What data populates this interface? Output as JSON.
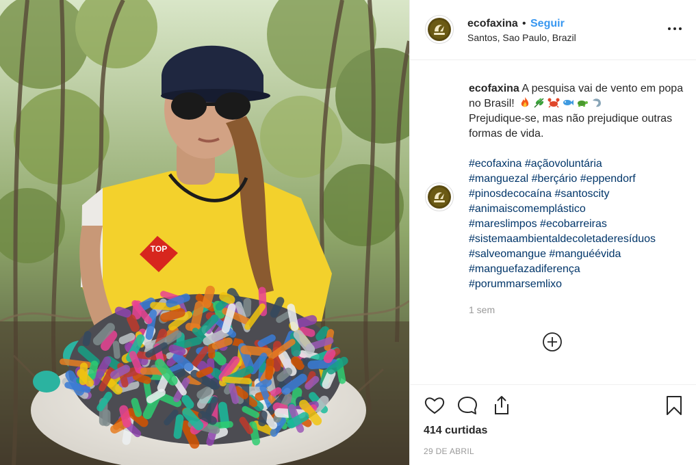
{
  "post": {
    "username": "ecofaxina",
    "separator": "•",
    "follow_label": "Seguir",
    "location": "Santos, Sao Paulo, Brazil",
    "more_options_icon": "more-horizontal-icon"
  },
  "caption": {
    "username": "ecofaxina",
    "text_line1": "A pesquisa vai de vento em popa no Brasil!",
    "emojis": [
      "fire",
      "leaves",
      "crab",
      "fish",
      "turtle",
      "dolphin"
    ],
    "text_line2": "Prejudique-se, mas não prejudique outras formas de vida."
  },
  "hashtag_lines": [
    [
      "#ecofaxina",
      "#açãovoluntária"
    ],
    [
      "#manguezal",
      "#berçário",
      "#eppendorf"
    ],
    [
      "#pinosdecocaína",
      "#santoscity"
    ],
    [
      "#animaiscomemplástico"
    ],
    [
      "#mareslimpos",
      "#ecobarreiras"
    ],
    [
      "#sistemaambientaldecoletaderesíduos"
    ],
    [
      "#salveomangue",
      "#manguéévida"
    ],
    [
      "#manguefazadiferença"
    ],
    [
      "#porummarsemlixo"
    ]
  ],
  "comment_time": "1 sem",
  "load_more_icon": "plus-circle-icon",
  "actions": {
    "like_icon": "heart-icon",
    "comment_icon": "comment-icon",
    "share_icon": "share-icon",
    "save_icon": "bookmark-icon"
  },
  "likes_text": "414 curtidas",
  "post_date": "29 DE ABRIL",
  "photo": {
    "vest_badge_text": "TOP"
  }
}
